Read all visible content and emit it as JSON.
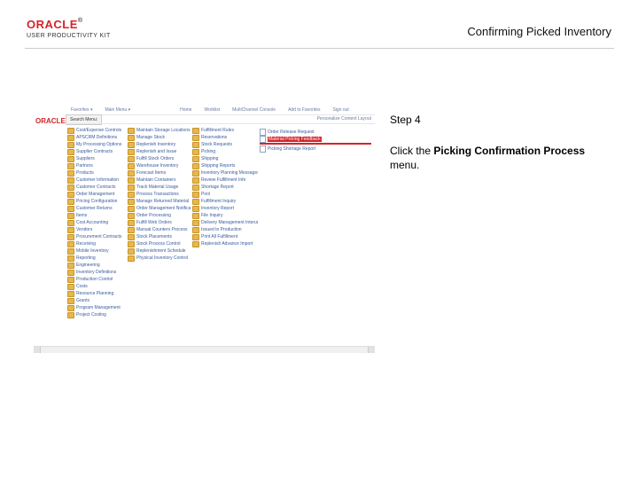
{
  "brand": {
    "logo_text": "ORACLE",
    "reg": "®",
    "upk_text": "USER PRODUCTIVITY KIT"
  },
  "page_title": "Confirming Picked Inventory",
  "instruction": {
    "step_label": "Step 4",
    "lead_in": "Click the ",
    "bold": "Picking Confirmation Process",
    "trail": " menu."
  },
  "screenshot": {
    "oracle_small": "ORACLE",
    "header_tabs": [
      "Favorites ▾",
      "Main Menu ▾",
      "",
      "",
      "",
      "Home",
      "Worklist",
      "MultiChannel Console",
      "Add to Favorites",
      "Sign out"
    ],
    "subbar_right": "Personalize Content  Layout",
    "search_label": "Search Menu:",
    "col0": [
      "Cost/Expense Controls",
      "APSCRM Definitions",
      "My Processing Options",
      "Supplier Contracts",
      "Suppliers",
      "Partners",
      "Products",
      "Customer Information",
      "Customer Contracts",
      "Order Management",
      "Pricing Configuration",
      "Customer Returns",
      "Items",
      "Cost Accounting",
      "Vendors",
      "Procurement Contracts",
      "Receiving",
      "Mobile Inventory",
      "Reporting",
      "Engineering",
      "Inventory Definitions",
      "Production Control",
      "Costs",
      "Resource Planning",
      "Grants",
      "Program Management",
      "Project Costing"
    ],
    "col1": [
      "Maintain Storage Locations",
      "Manage Stock",
      "Replenish Inventory",
      "Replenish and Issue",
      "Fulfill Stock Orders",
      "Warehouse Inventory",
      "Forecast Items",
      "Maintain Containers",
      "Track Material Usage",
      "Process Transactions",
      "Manage Returned Material",
      "Order Management Notification",
      "Order Processing",
      "Fulfill Web Orders",
      "Manual Counters Process",
      "Stock Placements",
      "Stock Process Control",
      "Replenishment Schedule",
      "Physical Inventory Control"
    ],
    "col2": [
      "Fulfillment Rules",
      "Reservations",
      "Stock Requests",
      "Picking",
      "Shipping",
      "Shipping Reports",
      "Inventory Planning Messages",
      "Review Fulfillment Info",
      "Shortage Report",
      "Pool",
      "Fulfillment Inquiry",
      "Inventory Report",
      "File Inquiry",
      "Delivery Management Interunit",
      "Issued to Production",
      "Print All Fulfillment",
      "Replenish Advance Import"
    ],
    "col3_header": "",
    "col3": [
      "Order Release Request",
      "Material Picking Feedback",
      "Picking Shortage Report"
    ],
    "col3_highlight_index": 1
  }
}
